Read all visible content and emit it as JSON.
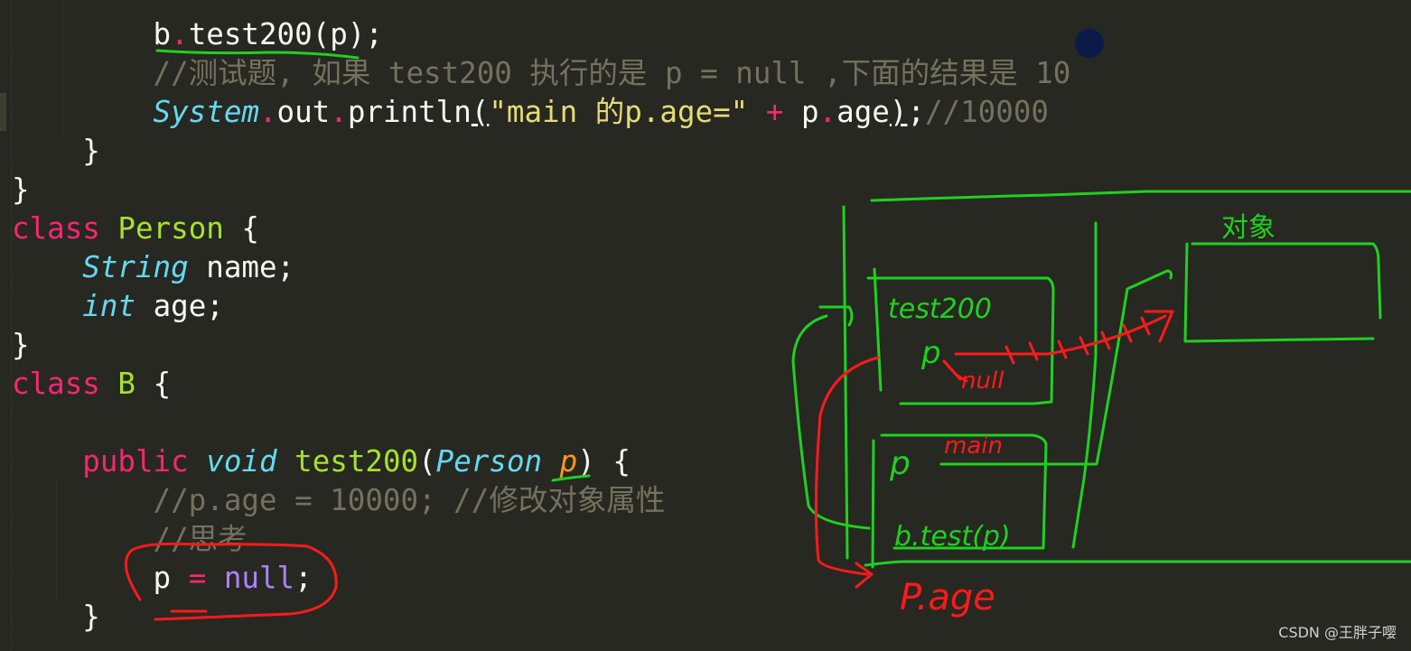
{
  "editor": {
    "theme_colors": {
      "background": "#272822",
      "keyword": "#f92672",
      "type": "#66d9ef",
      "class_name": "#a6e22e",
      "string": "#e6db74",
      "comment": "#75715e",
      "parameter": "#fd971f",
      "constant": "#ae81ff",
      "text": "#f8f8f2"
    },
    "lines": {
      "l1": {
        "obj": "b",
        "dot": ".",
        "call": "test200(p);"
      },
      "l2": {
        "comment": "//测试题, 如果 test200 执行的是 p = null ,下面的结果是 10"
      },
      "l3": {
        "cls": "System",
        "dot1": ".",
        "out": "out",
        "dot2": ".",
        "method": "println",
        "open": "(",
        "str": "\"main 的p.age=\"",
        "plus": "+",
        "p": "p",
        "dot3": ".",
        "age": "age",
        "close": ")",
        "semi": ";",
        "comment": "//10000"
      },
      "l4": {
        "text": "}"
      },
      "l5": {
        "text": "}"
      },
      "l6": {
        "kw": "class",
        "name": "Person",
        "brace": "{"
      },
      "l7": {
        "type": "String",
        "text": "name;"
      },
      "l8": {
        "type": "int",
        "text": "age;"
      },
      "l9": {
        "text": "}"
      },
      "l10": {
        "kw": "class",
        "name": "B",
        "brace": "{"
      },
      "l12": {
        "kw": "public",
        "type": "void",
        "fn": "test200",
        "open": "(",
        "ptype": "Person",
        "param": "p",
        "close": ")",
        "brace": "{"
      },
      "l13": {
        "comment": "//p.age = 10000; //修改对象属性"
      },
      "l14": {
        "comment": "//思考"
      },
      "l15": {
        "var": "p",
        "op": "=",
        "const": "null",
        "semi": ";"
      },
      "l16": {
        "text": "}"
      }
    }
  },
  "diagram": {
    "stroke_colors": {
      "green": "#1fd11f",
      "red": "#ff1a1a"
    },
    "labels": {
      "heap_object": "对象",
      "frame_test200": "test200",
      "frame_test200_var": "p",
      "null_note": "null",
      "frame_main_var": "p",
      "main_note": "main",
      "frame_main_call": "b.test(p)",
      "output_note": "P.age"
    }
  },
  "watermark": "CSDN @王胖子嘤"
}
